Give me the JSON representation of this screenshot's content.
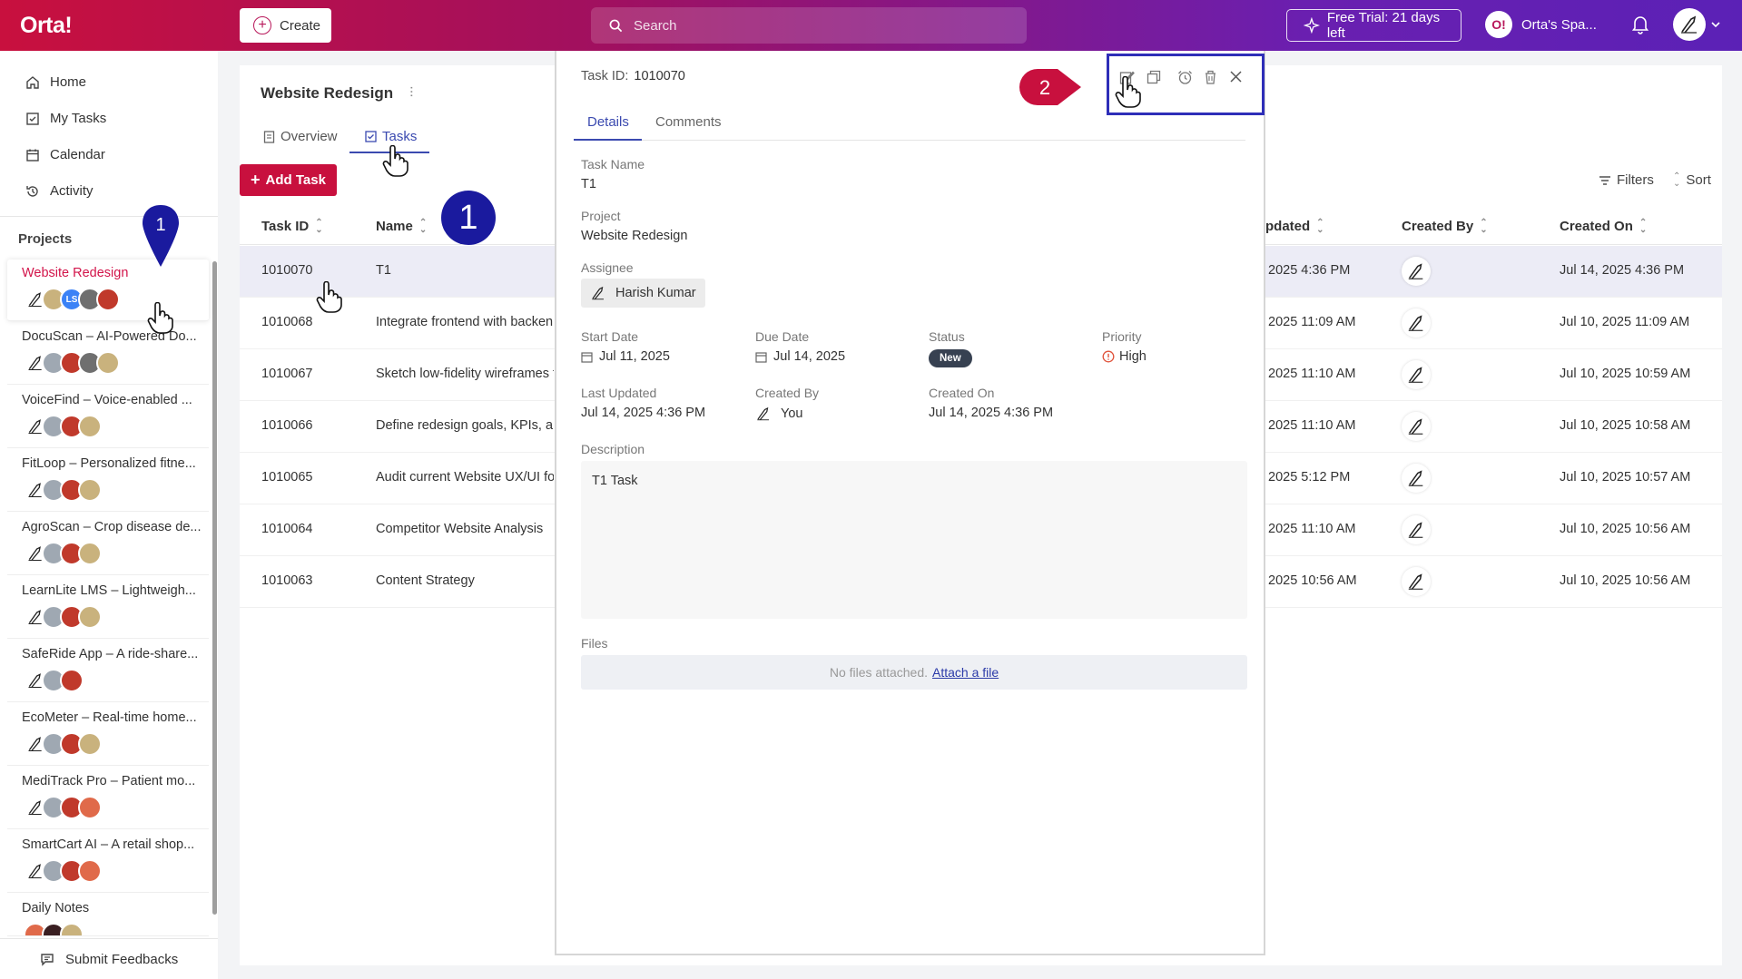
{
  "app": {
    "logo": "Orta!",
    "create_label": "Create",
    "search_placeholder": "Search",
    "trial_label": "Free Trial: 21 days left",
    "space_logo": "O!",
    "space_name": "Orta's Spa..."
  },
  "nav": [
    {
      "label": "Home",
      "icon": "home-icon"
    },
    {
      "label": "My Tasks",
      "icon": "checkbox-icon"
    },
    {
      "label": "Calendar",
      "icon": "calendar-icon"
    },
    {
      "label": "Activity",
      "icon": "history-icon"
    }
  ],
  "projects_heading": "Projects",
  "projects": [
    {
      "name": "Website Redesign",
      "active": true
    },
    {
      "name": "DocuScan – AI-Powered Do..."
    },
    {
      "name": "VoiceFind – Voice-enabled ..."
    },
    {
      "name": "FitLoop – Personalized fitne..."
    },
    {
      "name": "AgroScan – Crop disease de..."
    },
    {
      "name": "LearnLite LMS – Lightweigh..."
    },
    {
      "name": "SafeRide App – A ride-share..."
    },
    {
      "name": "EcoMeter – Real-time home..."
    },
    {
      "name": "MediTrack Pro – Patient mo..."
    },
    {
      "name": "SmartCart AI – A retail shop..."
    },
    {
      "name": "Daily Notes"
    }
  ],
  "submit_feedback": "Submit Feedbacks",
  "main": {
    "project_title": "Website Redesign",
    "tabs": [
      {
        "label": "Overview"
      },
      {
        "label": "Tasks",
        "active": true
      }
    ],
    "add_task": "Add Task",
    "filters": "Filters",
    "sort": "Sort",
    "columns": {
      "task_id": "Task ID",
      "name": "Name",
      "updated": "pdated",
      "created_by": "Created By",
      "created_on": "Created On"
    },
    "rows": [
      {
        "id": "1010070",
        "name": "T1",
        "updated": "2025 4:36 PM",
        "created_on": "Jul 14, 2025 4:36 PM",
        "selected": true
      },
      {
        "id": "1010068",
        "name": "Integrate frontend with backen",
        "updated": "2025 11:09 AM",
        "created_on": "Jul 10, 2025 11:09 AM"
      },
      {
        "id": "1010067",
        "name": "Sketch low-fidelity wireframes f",
        "updated": "2025 11:10 AM",
        "created_on": "Jul 10, 2025 10:59 AM"
      },
      {
        "id": "1010066",
        "name": "Define redesign goals, KPIs, and",
        "updated": "2025 11:10 AM",
        "created_on": "Jul 10, 2025 10:58 AM"
      },
      {
        "id": "1010065",
        "name": "Audit current Website UX/UI fo",
        "updated": "2025 5:12 PM",
        "created_on": "Jul 10, 2025 10:57 AM"
      },
      {
        "id": "1010064",
        "name": "Competitor Website Analysis",
        "updated": "2025 11:10 AM",
        "created_on": "Jul 10, 2025 10:56 AM"
      },
      {
        "id": "1010063",
        "name": "Content Strategy",
        "updated": "2025 10:56 AM",
        "created_on": "Jul 10, 2025 10:56 AM"
      }
    ]
  },
  "panel": {
    "task_id_label": "Task ID:",
    "task_id": "1010070",
    "tabs": [
      "Details",
      "Comments"
    ],
    "task_name_label": "Task Name",
    "task_name": "T1",
    "project_label": "Project",
    "project": "Website Redesign",
    "assignee_label": "Assignee",
    "assignee": "Harish Kumar",
    "start_label": "Start Date",
    "start": "Jul 11, 2025",
    "due_label": "Due Date",
    "due": "Jul 14, 2025",
    "status_label": "Status",
    "status": "New",
    "priority_label": "Priority",
    "priority": "High",
    "updated_label": "Last Updated",
    "updated": "Jul 14, 2025 4:36 PM",
    "created_by_label": "Created By",
    "created_by": "You",
    "created_on_label": "Created On",
    "created_on": "Jul 14, 2025 4:36 PM",
    "description_label": "Description",
    "description": "T1 Task",
    "files_label": "Files",
    "no_files": "No files attached.",
    "attach": "Attach a file"
  },
  "markers": {
    "m1a": "1",
    "m1b": "1",
    "m2": "2"
  },
  "colors": {
    "accent": "#c8103e",
    "primary": "#3b4ab0",
    "marker_blue": "#1a1a9e",
    "marker_red": "#c8103e"
  }
}
